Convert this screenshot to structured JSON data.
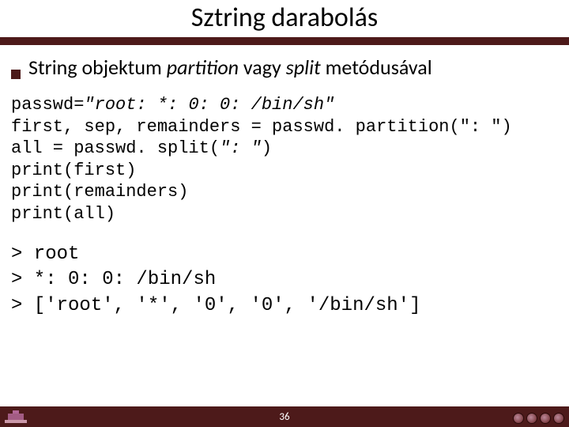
{
  "header": {
    "title": "Sztring darabolás"
  },
  "bullet": {
    "pre": "String objektum ",
    "em1": "partition",
    "mid": " vagy ",
    "em2": "split",
    "post": " metódusával"
  },
  "code": {
    "l1a": "passwd=",
    "l1b": "\"root: *: 0: 0: /bin/sh\"",
    "l2": "first, sep, remainders = passwd. partition(\": \")",
    "l3a": "all = passwd. split(",
    "l3b": "\": \"",
    "l3c": ")",
    "l4": "print(first)",
    "l5": "print(remainders)",
    "l6": "print(all)"
  },
  "output": {
    "l1": "> root",
    "l2": "> *: 0: 0: /bin/sh",
    "l3": "> ['root', '*', '0', '0', '/bin/sh']"
  },
  "footer": {
    "page": "36"
  }
}
